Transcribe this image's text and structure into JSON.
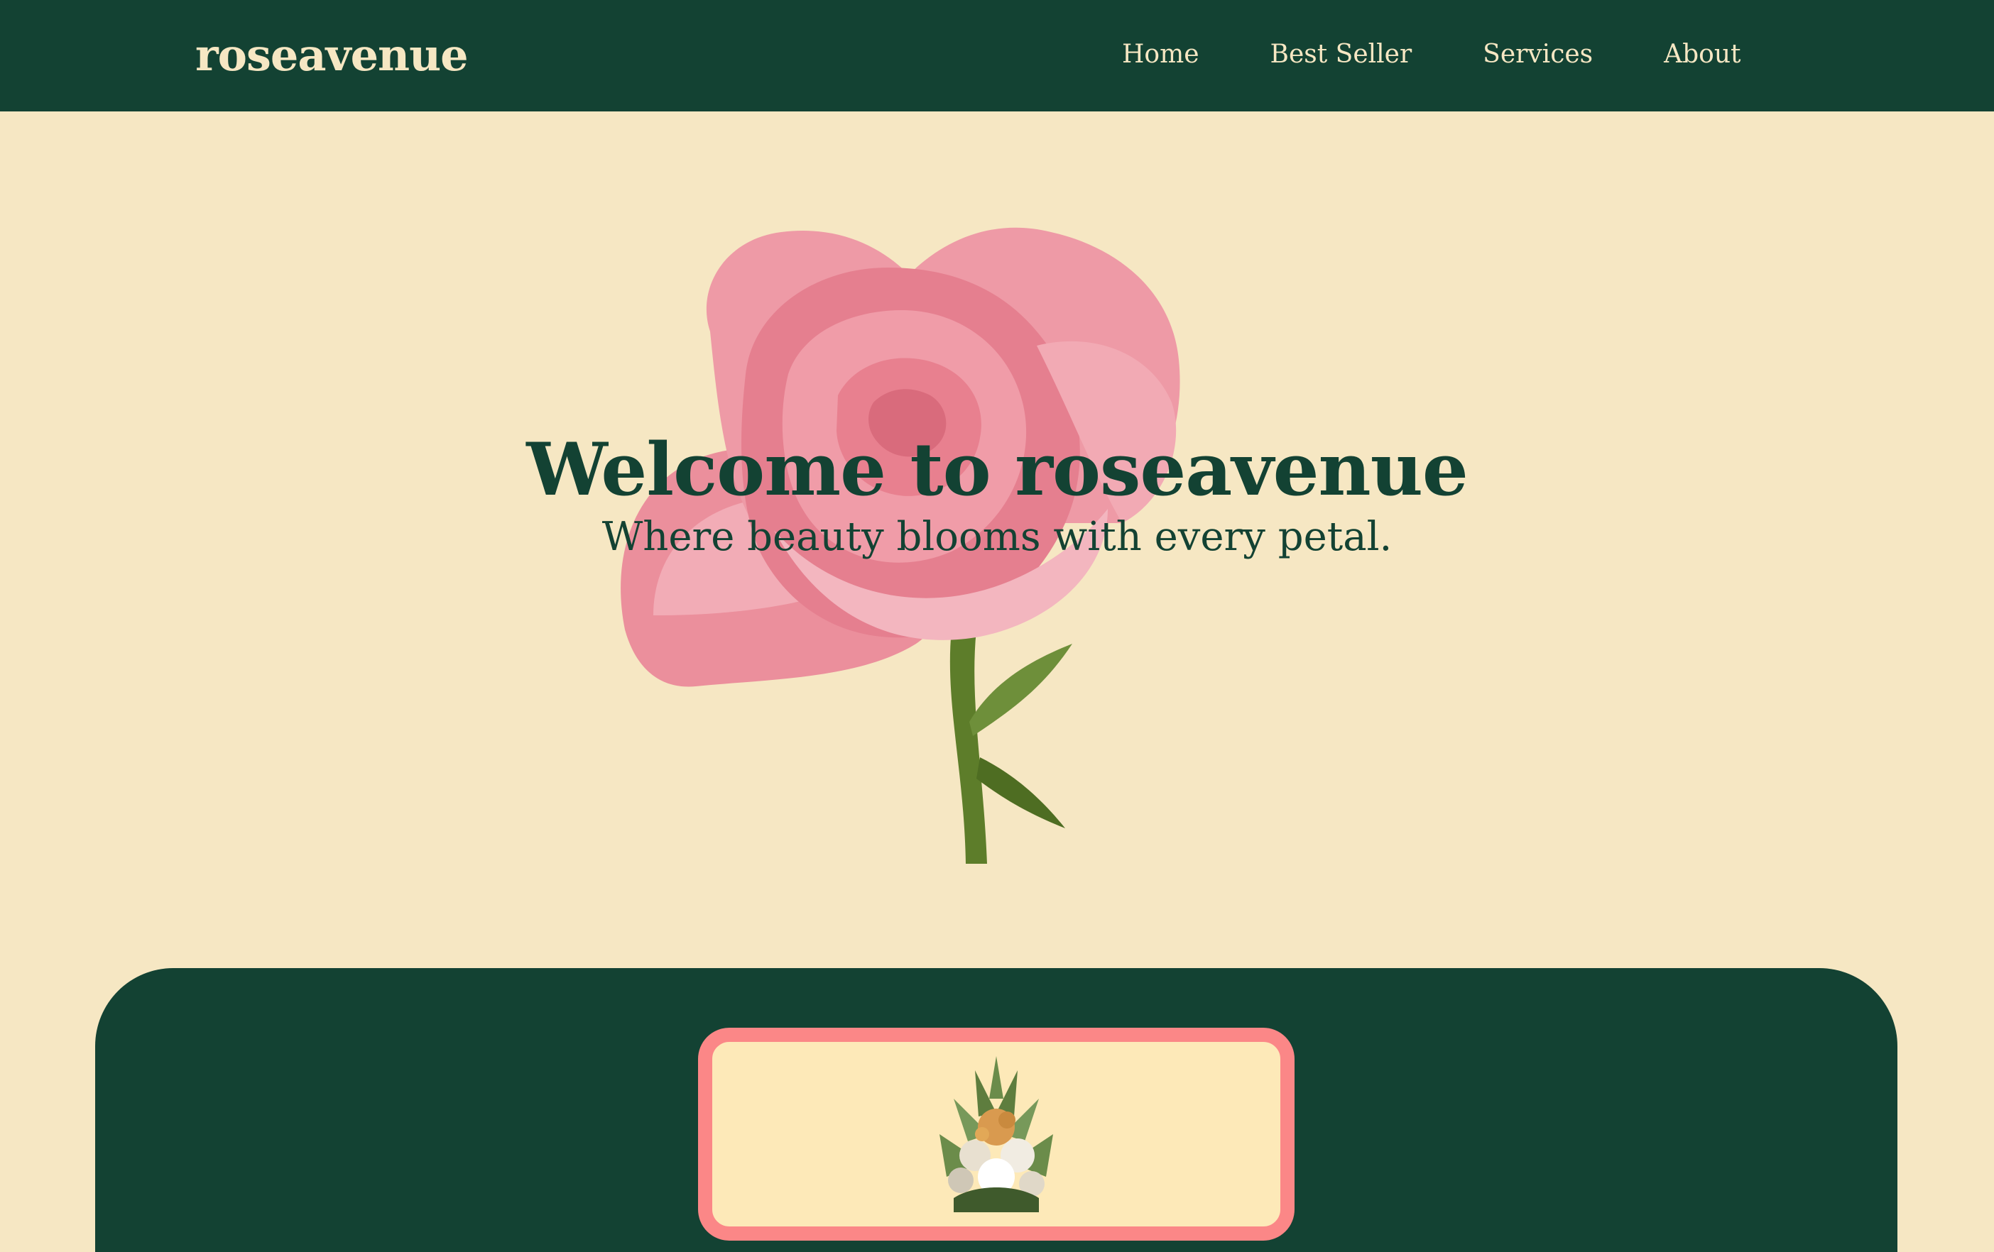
{
  "header": {
    "brand": "roseavenue",
    "nav": [
      {
        "label": "Home"
      },
      {
        "label": "Best Seller"
      },
      {
        "label": "Services"
      },
      {
        "label": "About"
      }
    ]
  },
  "hero": {
    "title": "Welcome to roseavenue",
    "subtitle": "Where beauty blooms with every petal."
  },
  "colors": {
    "primary": "#134233",
    "background": "#f6e7c3",
    "accent_pink": "#fb8787",
    "card_bg": "#fde9b8"
  },
  "images": {
    "hero": "rose-image",
    "card": "bouquet-image"
  }
}
